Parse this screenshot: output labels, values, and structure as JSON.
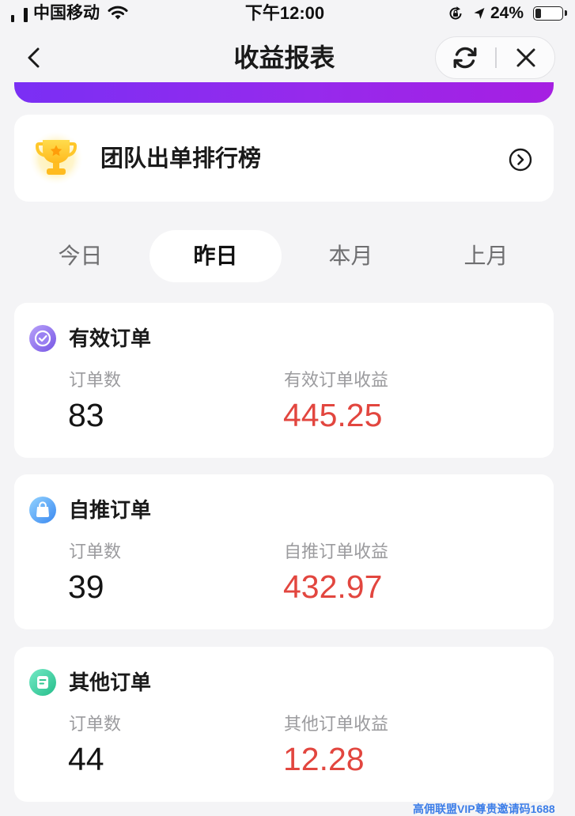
{
  "status_bar": {
    "carrier": "中国移动",
    "time": "下午12:00",
    "battery_text": "24%",
    "battery_level": 0.24,
    "icons": [
      "signal-icon",
      "wifi-icon",
      "orientation-lock-icon",
      "location-icon",
      "battery-icon"
    ]
  },
  "nav": {
    "title": "收益报表",
    "back_icon": "chevron-left-icon",
    "refresh_icon": "refresh-icon",
    "close_icon": "close-icon"
  },
  "ranking": {
    "label": "团队出单排行榜",
    "icon": "trophy-icon",
    "arrow_icon": "chevron-right-circle-icon"
  },
  "tabs": [
    {
      "label": "今日",
      "selected": false
    },
    {
      "label": "昨日",
      "selected": true
    },
    {
      "label": "本月",
      "selected": false
    },
    {
      "label": "上月",
      "selected": false
    }
  ],
  "cards": [
    {
      "title": "有效订单",
      "icon": "check-badge-icon",
      "count_label": "订单数",
      "count": "83",
      "income_label": "有效订单收益",
      "income": "445.25"
    },
    {
      "title": "自推订单",
      "icon": "shopping-bag-icon",
      "count_label": "订单数",
      "count": "39",
      "income_label": "自推订单收益",
      "income": "432.97"
    },
    {
      "title": "其他订单",
      "icon": "document-icon",
      "count_label": "订单数",
      "count": "44",
      "income_label": "其他订单收益",
      "income": "12.28"
    }
  ],
  "colors": {
    "page_bg": "#f4f4f6",
    "brand_purple": "#8a2be2",
    "income_red": "#e2463f",
    "watermark_blue": "#3d7ee8"
  },
  "watermark": "高佣联盟VIP尊贵邀请码1688"
}
